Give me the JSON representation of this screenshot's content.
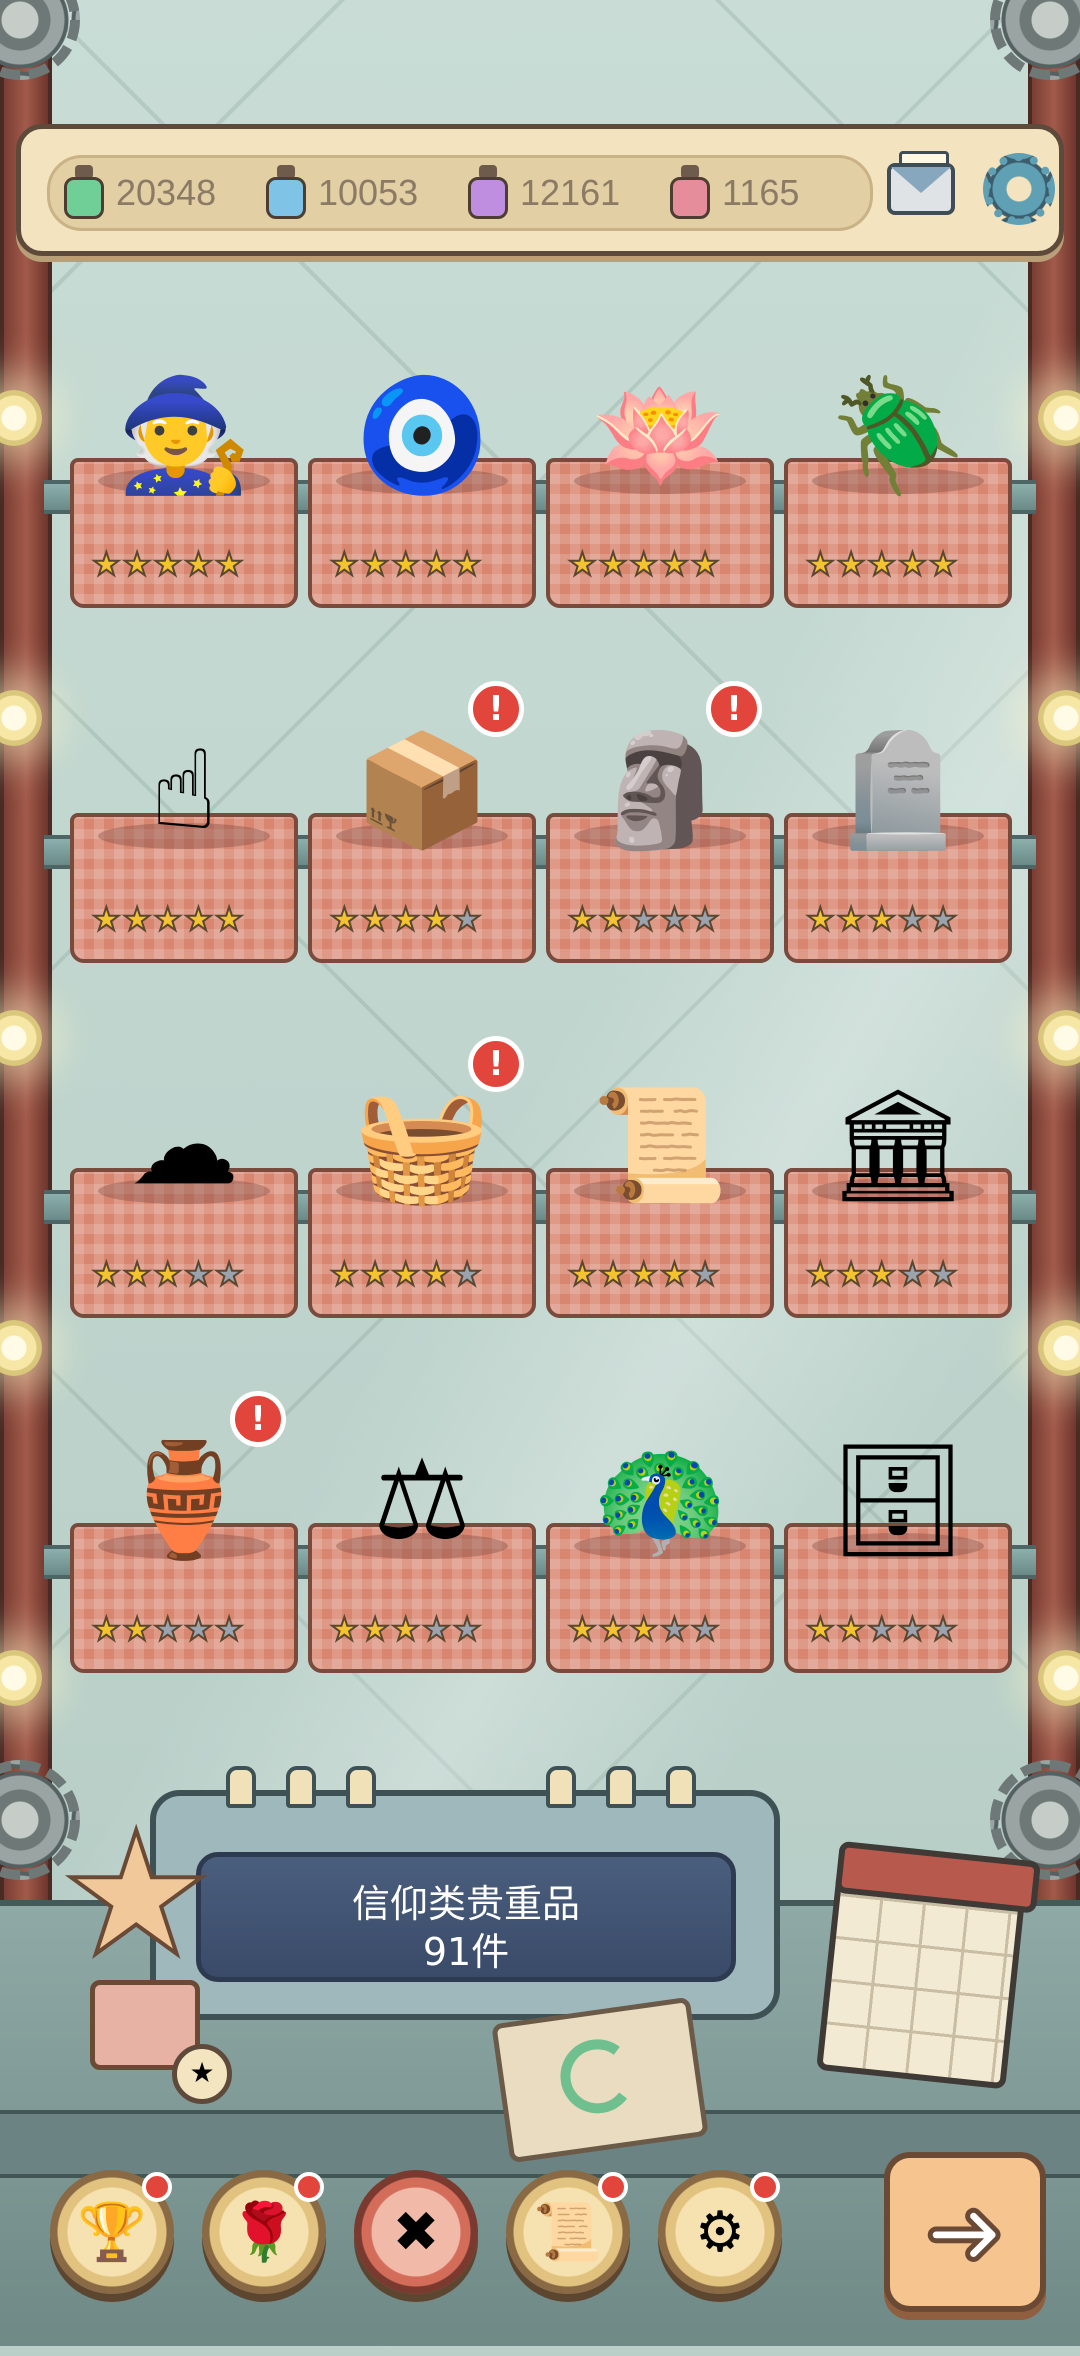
{
  "resources": [
    {
      "icon": "green-ink-bottle-icon",
      "color": "#6fcf97",
      "value": "20348"
    },
    {
      "icon": "blue-ink-bottle-icon",
      "color": "#7fc3e6",
      "value": "10053"
    },
    {
      "icon": "purple-ink-bottle-icon",
      "color": "#c08ee0",
      "value": "12161"
    },
    {
      "icon": "red-ink-bottle-icon",
      "color": "#e58d9a",
      "value": "1165"
    }
  ],
  "shelves": [
    [
      {
        "name": "sage-bust",
        "glyph": "🧙",
        "stars": 5,
        "alert": false
      },
      {
        "name": "ring-relic",
        "glyph": "🧿",
        "stars": 5,
        "alert": false
      },
      {
        "name": "lotus-throne",
        "glyph": "🪷",
        "stars": 5,
        "alert": false
      },
      {
        "name": "scarab-relic",
        "glyph": "🪲",
        "stars": 5,
        "alert": false
      }
    ],
    [
      {
        "name": "golden-finger-statue",
        "glyph": "☝",
        "stars": 5,
        "alert": false
      },
      {
        "name": "ark-chest",
        "glyph": "📦",
        "stars": 4,
        "alert": true
      },
      {
        "name": "three-faced-bust",
        "glyph": "🗿",
        "stars": 2,
        "alert": true
      },
      {
        "name": "stone-tablet",
        "glyph": "🪦",
        "stars": 3,
        "alert": false
      }
    ],
    [
      {
        "name": "auspicious-cloud",
        "glyph": "☁",
        "stars": 3,
        "alert": false
      },
      {
        "name": "bread-basket",
        "glyph": "🧺",
        "stars": 4,
        "alert": true
      },
      {
        "name": "ancient-scroll",
        "glyph": "📜",
        "stars": 4,
        "alert": false
      },
      {
        "name": "golden-shrine",
        "glyph": "🏛",
        "stars": 3,
        "alert": false
      }
    ],
    [
      {
        "name": "bronze-vessel",
        "glyph": "🏺",
        "stars": 2,
        "alert": true
      },
      {
        "name": "scales-of-justice",
        "glyph": "⚖",
        "stars": 3,
        "alert": false
      },
      {
        "name": "peacock-fan",
        "glyph": "🦚",
        "stars": 3,
        "alert": false
      },
      {
        "name": "carved-stone",
        "glyph": "🗄",
        "stars": 2,
        "alert": false
      }
    ]
  ],
  "collection": {
    "title": "信仰类贵重品",
    "count": "91件"
  },
  "nav": [
    {
      "icon": "trophy-icon",
      "glyph": "🏆",
      "dot": true,
      "active": false
    },
    {
      "icon": "rose-icon",
      "glyph": "🌹",
      "dot": true,
      "active": false
    },
    {
      "icon": "cross-icon",
      "glyph": "✖",
      "dot": false,
      "active": true
    },
    {
      "icon": "scroll-icon",
      "glyph": "📜",
      "dot": true,
      "active": false
    },
    {
      "icon": "gear-icon",
      "glyph": "⚙",
      "dot": true,
      "active": false
    }
  ],
  "next_arrow": "➜"
}
